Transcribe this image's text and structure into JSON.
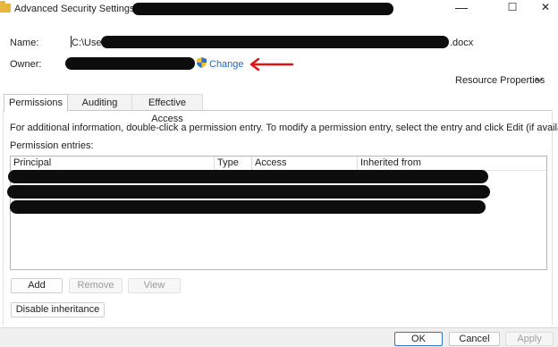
{
  "window": {
    "title": "Advanced Security Settings for ",
    "minimize_glyph": "—",
    "maximize_glyph": "☐",
    "close_glyph": "✕"
  },
  "name_row": {
    "label": "Name:",
    "value_prefix": "C:\\Users",
    "value_suffix": ".docx"
  },
  "owner_row": {
    "label": "Owner:",
    "change_link": "Change",
    "icon": "shield-icon"
  },
  "resource_properties": {
    "label": "Resource Properties",
    "icon": "chevron-down-icon"
  },
  "tabs": [
    {
      "label": "Permissions",
      "active": true
    },
    {
      "label": "Auditing",
      "active": false
    },
    {
      "label": "Effective Access",
      "active": false
    }
  ],
  "info_text": "For additional information, double-click a permission entry. To modify a permission entry, select the entry and click Edit (if available).",
  "entries_label": "Permission entries:",
  "table": {
    "columns": [
      "Principal",
      "Type",
      "Access",
      "Inherited from"
    ]
  },
  "buttons": {
    "add": "Add",
    "remove": "Remove",
    "view": "View",
    "disable_inheritance": "Disable inheritance"
  },
  "footer": {
    "ok": "OK",
    "cancel": "Cancel",
    "apply": "Apply"
  },
  "colors": {
    "link": "#1a6bc4",
    "arrow": "#e01414",
    "redaction": "#0d0d0d"
  }
}
